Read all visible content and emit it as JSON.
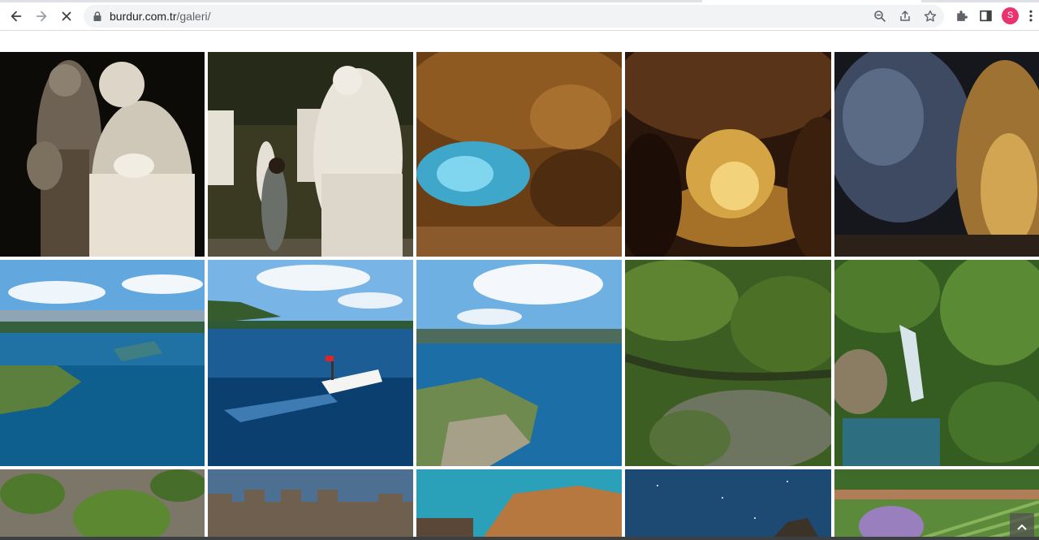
{
  "browser": {
    "url_host": "burdur.com.tr",
    "url_path": "/galeri/",
    "avatar_letter": "S",
    "icons": [
      "back-arrow-icon",
      "forward-arrow-icon",
      "stop-loading-icon",
      "lock-icon",
      "zoom-icon",
      "share-icon",
      "star-icon",
      "extensions-icon",
      "side-panel-icon",
      "kebab-menu-icon"
    ],
    "colors": {
      "omnibox_bg": "#f1f3f4",
      "avatar_bg": "#e8336e"
    }
  },
  "gallery": {
    "photos": [
      {
        "subject": "Marble female statues in museum"
      },
      {
        "subject": "Visitor beside seated marble statue in museum"
      },
      {
        "subject": "Cave interior lit in blue and orange"
      },
      {
        "subject": "Cave passage lit in gold"
      },
      {
        "subject": "Cave with blue and golden rock walls"
      },
      {
        "subject": "Aerial view of blue lake with islands"
      },
      {
        "subject": "Boat with Turkish flag on lake"
      },
      {
        "subject": "Aerial view of lake peninsula"
      },
      {
        "subject": "Aerial view of forest canyon"
      },
      {
        "subject": "Waterfall in green forest"
      },
      {
        "subject": "Aerial view of trees and rocks"
      },
      {
        "subject": "Ancient castle walls"
      },
      {
        "subject": "Rock formations by turquoise water"
      },
      {
        "subject": "Starry night sky over rocks"
      },
      {
        "subject": "Lavender and vineyard fields"
      }
    ],
    "scroll_top_icon": "chevron-up-icon"
  }
}
